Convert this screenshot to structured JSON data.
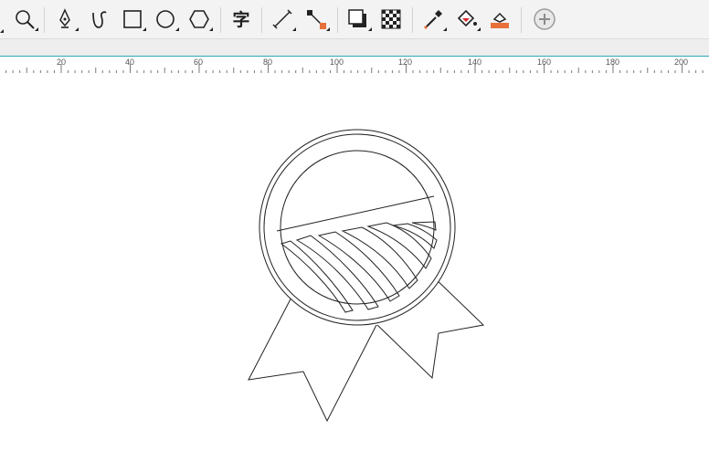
{
  "toolbar": {
    "tools": [
      {
        "name": "zoom-tool",
        "icon": "magnifier-icon"
      },
      {
        "name": "pen-tool",
        "icon": "pen-nib-icon"
      },
      {
        "name": "artistic-media-tool",
        "icon": "curve-icon"
      },
      {
        "name": "rectangle-tool",
        "icon": "rectangle-icon"
      },
      {
        "name": "ellipse-tool",
        "icon": "ellipse-icon"
      },
      {
        "name": "polygon-tool",
        "icon": "hexagon-icon"
      },
      {
        "name": "text-tool",
        "icon": "text-glyph-icon",
        "glyph": "字"
      },
      {
        "name": "dimension-tool",
        "icon": "dimension-icon"
      },
      {
        "name": "connector-tool",
        "icon": "connector-icon"
      },
      {
        "name": "drop-shadow-tool",
        "icon": "drop-shadow-icon"
      },
      {
        "name": "transparency-tool",
        "icon": "checkerboard-icon"
      },
      {
        "name": "eyedropper-tool",
        "icon": "eyedropper-icon"
      },
      {
        "name": "interactive-fill-tool",
        "icon": "fill-bucket-icon"
      },
      {
        "name": "smart-fill-tool",
        "icon": "smart-fill-icon"
      },
      {
        "name": "add-tool-button",
        "icon": "plus-circle-icon"
      }
    ],
    "accent": "#e8703a"
  },
  "ruler": {
    "labels": [
      "20",
      "40",
      "60",
      "80",
      "100",
      "120",
      "140",
      "160",
      "180",
      "200"
    ],
    "accent": "#2aa8b8"
  },
  "canvas": {
    "drawing": "award-badge-icon"
  }
}
